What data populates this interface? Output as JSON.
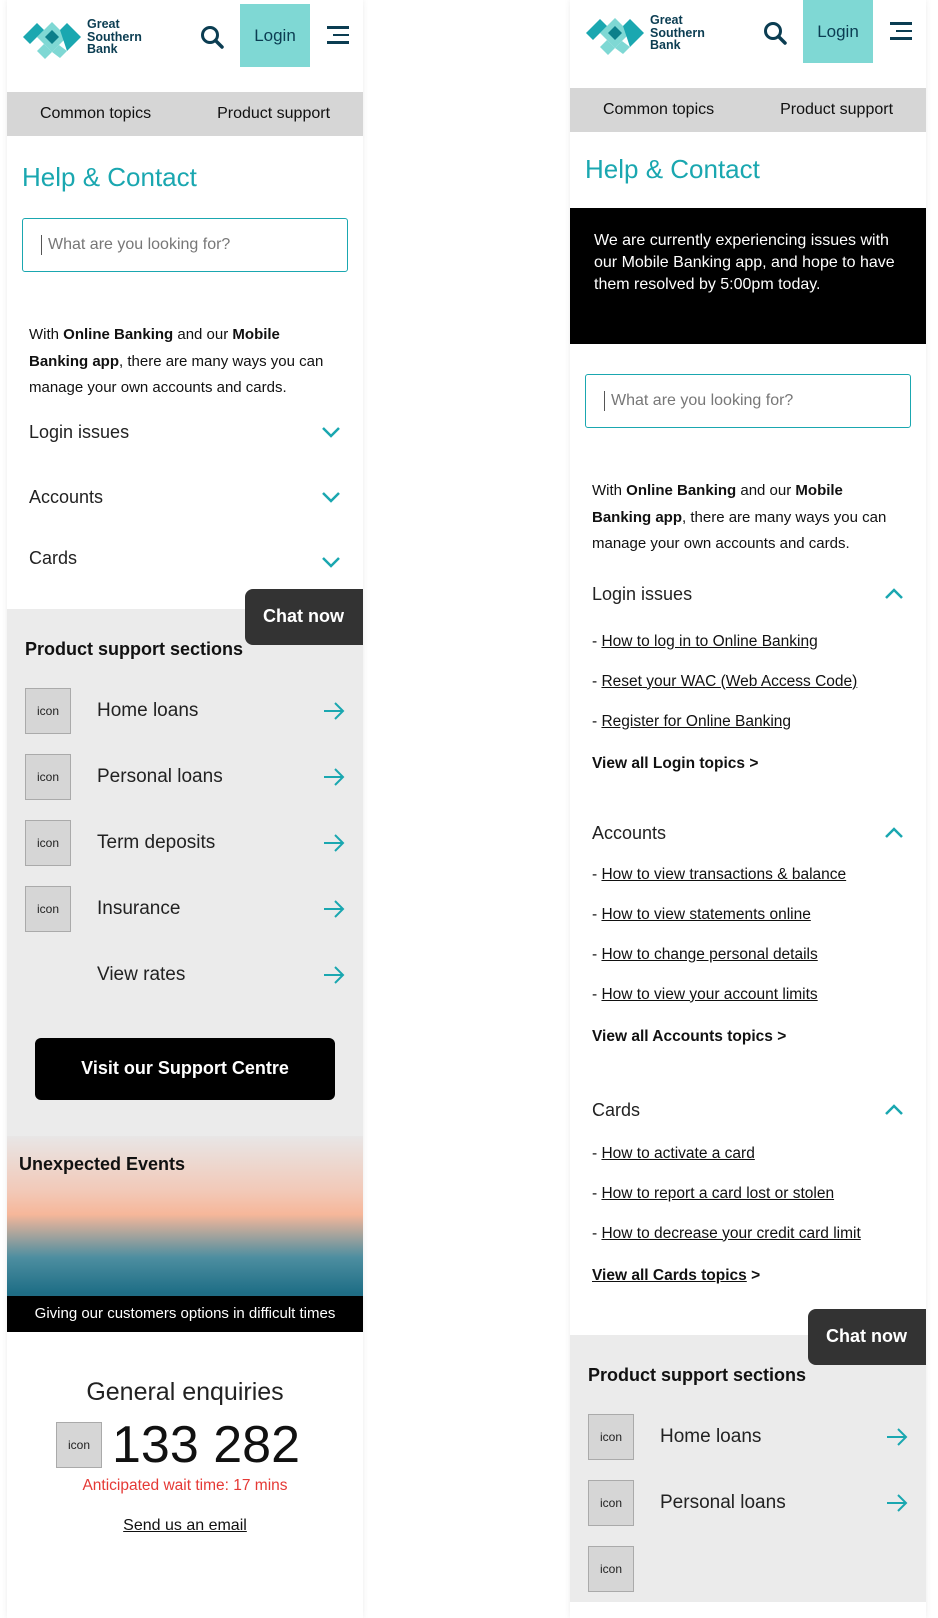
{
  "brand": {
    "name_lines": [
      "Great",
      "Southern",
      "Bank"
    ],
    "accent": "#1aa7b0",
    "login_bg": "#7fd8d4",
    "dark": "#0b3d52"
  },
  "header": {
    "login_label": "Login"
  },
  "subnav": {
    "items": [
      "Common topics",
      "Product support"
    ]
  },
  "page": {
    "title": "Help & Contact"
  },
  "alert": {
    "text": "We are currently experiencing issues with our Mobile Banking app, and hope to have them resolved by 5:00pm today."
  },
  "search": {
    "placeholder": "What are you looking for?"
  },
  "intro": {
    "p1": "With ",
    "b1": "Online Banking",
    "p2": " and our ",
    "b2": "Mobile Banking app",
    "p3": ", there are many ways you can manage your own accounts and cards."
  },
  "accordions": {
    "login": {
      "title": "Login issues",
      "links": [
        "How to log in to Online Banking",
        " Reset your WAC (Web Access Code)",
        "Register for Online Banking"
      ],
      "more": "View all Login topics >"
    },
    "accounts": {
      "title": "Accounts",
      "links": [
        "How to view transactions & balance",
        "How to view statements online",
        "How to change personal details",
        "How to view your account limits"
      ],
      "more": "View all Accounts topics >"
    },
    "cards": {
      "title": "Cards",
      "links": [
        "How to activate a card",
        "How to report a card lost or stolen",
        "How to decrease your credit card limit"
      ],
      "more_link": "View all Cards topics",
      "more_suffix": " >"
    }
  },
  "chat": {
    "label": "Chat now"
  },
  "product": {
    "title": "Product support sections",
    "icon_text": "icon",
    "items": [
      "Home loans",
      "Personal loans",
      "Term deposits",
      "Insurance",
      "View rates"
    ]
  },
  "cta": {
    "label": "Visit our Support Centre"
  },
  "event": {
    "title": "Unexpected Events",
    "caption": "Giving our customers options in difficult times"
  },
  "enquiries": {
    "title": "General enquiries",
    "number": "133 282",
    "wait": "Anticipated wait time: 17 mins",
    "email": "Send us an email"
  }
}
